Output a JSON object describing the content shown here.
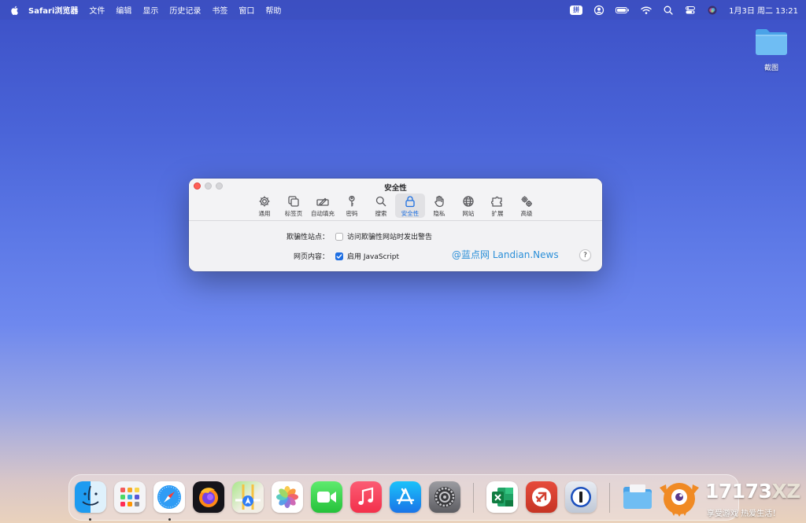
{
  "menubar": {
    "app_name": "Safari浏览器",
    "items": [
      "文件",
      "编辑",
      "显示",
      "历史记录",
      "书签",
      "窗口",
      "帮助"
    ],
    "input_method": "拼",
    "clock": "1月3日 周二  13:21"
  },
  "desktop": {
    "folder_label": "截图"
  },
  "window": {
    "title": "安全性",
    "tabs": [
      {
        "label": "通用",
        "icon": "gear-icon"
      },
      {
        "label": "标签页",
        "icon": "tabs-icon"
      },
      {
        "label": "自动填充",
        "icon": "autofill-pen-icon"
      },
      {
        "label": "密码",
        "icon": "key-icon"
      },
      {
        "label": "搜索",
        "icon": "search-icon"
      },
      {
        "label": "安全性",
        "icon": "lock-icon",
        "selected": true
      },
      {
        "label": "隐私",
        "icon": "hand-icon"
      },
      {
        "label": "网站",
        "icon": "globe-icon"
      },
      {
        "label": "扩展",
        "icon": "puzzle-icon"
      },
      {
        "label": "高级",
        "icon": "gears-icon"
      }
    ],
    "fraud_label": "欺骗性站点：",
    "fraud_checkbox": {
      "label": "访问欺骗性网站时发出警告",
      "checked": false
    },
    "content_label": "网页内容：",
    "js_checkbox": {
      "label": "启用 JavaScript",
      "checked": true
    },
    "watermark": "@蓝点网 Landian.News",
    "help": "?"
  },
  "dock": {
    "apps": [
      "finder-icon",
      "launchpad-icon",
      "safari-icon",
      "firefox-icon",
      "maps-icon",
      "photos-icon",
      "facetime-icon",
      "music-icon",
      "app-store-icon",
      "system-settings-icon",
      "excel-icon",
      "remote-desktop-icon",
      "1password-icon",
      "downloads-folder-icon"
    ]
  },
  "badge": {
    "brand_num": "17173",
    "brand_xz": "XZ",
    "slogan": "享受游戏  热爱生活！"
  },
  "colors": {
    "accent": "#1d6fe0",
    "close": "#fe5f57"
  }
}
